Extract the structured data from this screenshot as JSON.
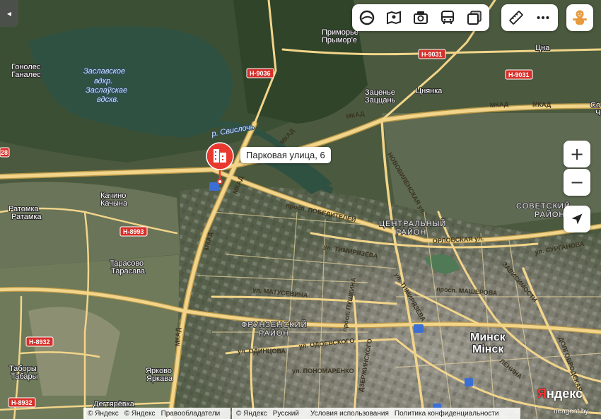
{
  "toolbar": {
    "buttons": [
      {
        "name": "layers-button",
        "icon": "layers-icon"
      },
      {
        "name": "panorama-button",
        "icon": "panorama-icon"
      },
      {
        "name": "photos-button",
        "icon": "camera-icon"
      },
      {
        "name": "transit-button",
        "icon": "bus-icon"
      },
      {
        "name": "maptype-button",
        "icon": "maptype-icon"
      }
    ],
    "ruler_icon": "ruler-icon",
    "more_icon": "more-icon",
    "profile_icon": "profile-avatar-icon"
  },
  "controls": {
    "zoom_in": "+",
    "zoom_out": "−",
    "collapse": "◂",
    "geolocation_icon": "geolocation-arrow-icon"
  },
  "marker": {
    "label": "Парковая улица, 6",
    "color": "#e9392f",
    "icon": "building-icon"
  },
  "places": {
    "reservoir": [
      "Заславское",
      "вдхр.",
      "Заслаўскае",
      "вдсхв."
    ],
    "river": "р. Свислочь",
    "primorye_ru": "Приморье",
    "primorye_by": "Прымор'е",
    "gonoles_ru": "Гонолес",
    "gonoles_by": "Ганалес",
    "zatsen_ru": "Заценье",
    "zatsen_by": "Заццань",
    "tsnyanka": "Цнянка",
    "tsna": "Цна",
    "kachino_ru": "Качино",
    "kachino_by": "Качына",
    "ratomka_ru": "Ратомка",
    "ratomka_by": "Ратамка",
    "tarasovo_ru": "Тарасово",
    "tarasovo_by": "Тарасава",
    "tabory_ru": "Таборы",
    "tabory_by": "Табары",
    "yarkovo_ru": "Ярково",
    "yarkovo_by": "Яркава",
    "degtyarevka": "Дегтярёвка",
    "so": "Со",
    "ch": "Ч",
    "minsk_ru": "Минск",
    "minsk_by": "Мінск",
    "central_district": [
      "ЦЕНТРАЛЬНЫЙ",
      "РАЙОН"
    ],
    "soviet_district": [
      "СОВЕТСКИЙ",
      "РАЙОН"
    ],
    "frunze_district": [
      "ФРУНЗЕНСКИЙ",
      "РАЙОН"
    ]
  },
  "roads": {
    "mkad": "МКАД",
    "pobediteley": "просп. ПОБЕДИТЕЛЕЙ",
    "timiryazeva": "ул. ТИМИРЯЗЕВА",
    "orlovskaya": "ОРЛОВСКАЯ ул.",
    "surganova": "ул. СУРГАНОВА",
    "masherova": "просп. МАШЕРОВА",
    "matusevicha": "ул. МАТУСЕВИЧА",
    "odintsova": "ул. ОДИНЦОВА",
    "odoevskogo": "ул. ОДОЕВСКОГО",
    "ponomarenko": "ул. ПОНОМАРЕНКО",
    "pushkina": "просп. ПУШКИНА",
    "novovilenskaya": "НОВОВИЛЕНСКАЯ ул.",
    "timiryazeva2": "ул. ТИМИРЯЗЕВА",
    "dolgobrodskaya": "ДОЛГОБРОДСКАЯ",
    "lenina": "ЛЕНИНА",
    "nezavisimosti": "ЗАВИСИМОСТИ",
    "dzerzhinskogo": "ДЗЕРЖИНСКОГО",
    "shields": [
      "Н-9031",
      "Н-9031",
      "Н-9036",
      "Н-8993",
      "Н-8932",
      "Н-8932",
      "28"
    ]
  },
  "colors": {
    "road": "#f2d58a",
    "road_casing": "#c9a95a",
    "shield": "#d6302a",
    "water": "#2c4a3c",
    "forest": "#2e4a2a",
    "city": "#8a8a80"
  },
  "footer": {
    "left": [
      "© Яндекс",
      "© Яндекс",
      "Правообладатели"
    ],
    "right": [
      "© Яндекс",
      "Русский",
      "Условия использования",
      "Политика конфиденциальности"
    ]
  },
  "logo": {
    "first": "Я",
    "rest": "ндекс"
  },
  "watermark": "neagent.by"
}
